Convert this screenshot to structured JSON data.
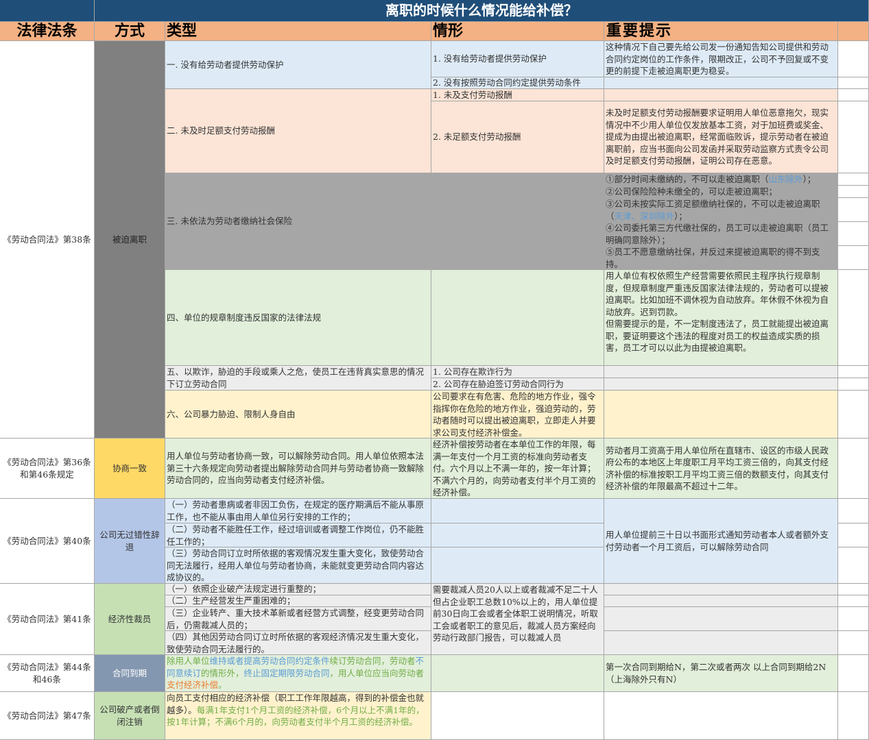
{
  "title": "离职的时候什么情况能给补偿？",
  "headers": [
    "法律法条",
    "方式",
    "类型",
    "情形",
    "重要提示"
  ],
  "section1": {
    "law": "《劳动合同法》第38条",
    "method": "被迫离职",
    "t1": "一. 没有给劳动者提供劳动保护",
    "s1a": "1. 没有给劳动者提供劳动保护",
    "s1b": "2. 没有按照劳动合同约定提供劳动条件",
    "n1": "这种情况下自己要先给公司发一份通知告知公司提供和劳动合同约定岗位的工作条件，限期改正，公司不予回复或不变更的前提下走被迫离职更为稳妥。",
    "t2": "二. 未及时足额支付劳动报酬",
    "s2a": "1. 未及支付劳动报酬",
    "s2b": "2. 未足额支付劳动报酬",
    "n2": "未及时足额支付劳动报酬要求证明用人单位恶意拖欠，现实情况中不少用人单位仅发放基本工资，对于加班费或奖金、提成为由提出被迫离职，经常面临败诉，提示劳动者在被迫离职前，应当书面向公司发函并采取劳动监察方式责令公司及时足额支付劳动报酬，证明公司存在恶意。",
    "t3": "三. 未依法为劳动者缴纳社会保险",
    "n3a_pre": "①部分时间未缴纳的，不可以走被迫离职（",
    "n3a_blue": "山东除外",
    "n3a_post": "）；",
    "n3b": "②公司保险险种未缴全的，可以走被迫离职；",
    "n3c_pre": "③公司未按实际工资足额缴纳社保的，不可以走被迫离职（",
    "n3c_blue": "天津、深圳除外",
    "n3c_post": "）；",
    "n3d": "④公司委托第三方代缴社保的，员工可以走被迫离职（员工明确同意除外）；",
    "n3e": "⑤员工不愿意缴纳社保，并反过来提被迫离职的得不到支持。",
    "t4": "四、单位的规章制度违反国家的法律法规",
    "n4": "用人单位有权依照生产经营需要依照民主程序执行规章制度，但规章制度严重违反国家法律法规的，劳动者可以提被迫离职。比如加班不调休视为自动放弃。年休假不休视为自动放弃。迟到罚款。\n但需要提示的是，不一定制度违法了，员工就能提出被迫离职，要证明要这个违法的程度对员工的权益造成实质的损害，员工才可以以此为由提被迫离职。",
    "t5": "五、以欺诈，胁迫的手段或乘人之危，使员工在违背真实意思的情况下订立劳动合同",
    "s5a": "1. 公司存在欺诈行为",
    "s5b": "2. 公司存在胁迫签订劳动合同行为",
    "t6": "六、公司暴力胁迫、限制人身自由",
    "s6": "公司要求在有危害、危险的地方作业，强令指挥你在危险的地方作业，强迫劳动的，劳动者随时可以提出被迫离职，立即走人并要求公司支付经济补偿金。"
  },
  "section2": {
    "law": "《劳动合同法》第36条和第46条规定",
    "method": "协商一致",
    "t": "用人单位与劳动者协商一致，可以解除劳动合同。用人单位依照本法第三十六条规定向劳动者提出解除劳动合同并与劳动者协商一致解除劳动合同的，应当向劳动者支付经济补偿。",
    "s": "经济补偿按劳动者在本单位工作的年限，每满一年支付一个月工资的标准向劳动者支付。六个月以上不满一年的，按一年计算；不满六个月的，向劳动者支付半个月工资的经济补偿。",
    "n": "劳动者月工资高于用人单位所在直辖市、设区的市级人民政府公布的本地区上年度职工月平均工资三倍的，向其支付经济补偿的标准按职工月平均工资三倍的数额支付，向其支付经济补偿的年限最高不超过十二年。"
  },
  "section3": {
    "law": "《劳动合同法》第40条",
    "method": "公司无过错性辞退",
    "t1": "（一）劳动者患病或者非因工负伤，在规定的医疗期满后不能从事原工作，也不能从事由用人单位另行安排的工作的；",
    "t2": "（二）劳动者不能胜任工作，经过培训或者调整工作岗位，仍不能胜任工作的；",
    "t3": "（三）劳动合同订立时所依据的客观情况发生重大变化，致使劳动合同无法履行，经用人单位与劳动者协商，未能就变更劳动合同内容达成协议的。",
    "n": "用人单位提前三十日以书面形式通知劳动者本人或者额外支付劳动者一个月工资后，可以解除劳动合同"
  },
  "section4": {
    "law": "《劳动合同法》第41条",
    "method": "经济性裁员",
    "t1": "（一）依照企业破产法规定进行重整的；",
    "t2": "（二）生产经营发生严重困难的；",
    "t3": "（三）企业转产、重大技术革新或者经营方式调整，经变更劳动合同后，仍需裁减人员的；",
    "t4": "（四）其他因劳动合同订立时所依据的客观经济情况发生重大变化，致使劳动合同无法履行的。",
    "s": "需要裁减人员20人以上或者裁减不足二十人但占企业职工总数10%以上的，用人单位提前30日向工会或者全体职工说明情况，听取工会或者职工的意见后，裁减人员方案经向劳动行政部门报告，可以裁减人员"
  },
  "section5": {
    "law": "《劳动合同法》第44条和46条",
    "method": "合同到期",
    "t_a": "除用人单位",
    "t_b": "维持或者提高劳动合同约定条件",
    "t_c": "续订劳动合同，劳动者",
    "t_d": "不同意续订",
    "t_e": "的情形外，",
    "t_f": "终止固定期限劳动合同",
    "t_g": "，用人单位应当向劳动者",
    "t_h": "支付经济补偿",
    "t_i": "。",
    "n": "第一次合同到期给N，第二次或者两次 以上合同到期给2N（上海除外只有N）"
  },
  "section6": {
    "law": "《劳动合同法》第47条",
    "method": "公司破产或者倒闭注销",
    "t_a": "向员工支付相应的经济补偿（职工工作年限越高，得到的补偿金也就越多）。",
    "t_b": "每满1年支付1个月工资的经济补偿，6个月以上不满1年的，按1年计算；不满6个月的，向劳动者支付半个月工资的经济补偿。"
  },
  "colors": {
    "title_bg": "#1f4e79",
    "header_bg": "#f4b183",
    "method_forced": "#808080",
    "method_negotiate": "#ffd966",
    "method_dismiss": "#b4c6e7",
    "method_layoff": "#c6e0b4",
    "method_expire": "#8497b0"
  }
}
